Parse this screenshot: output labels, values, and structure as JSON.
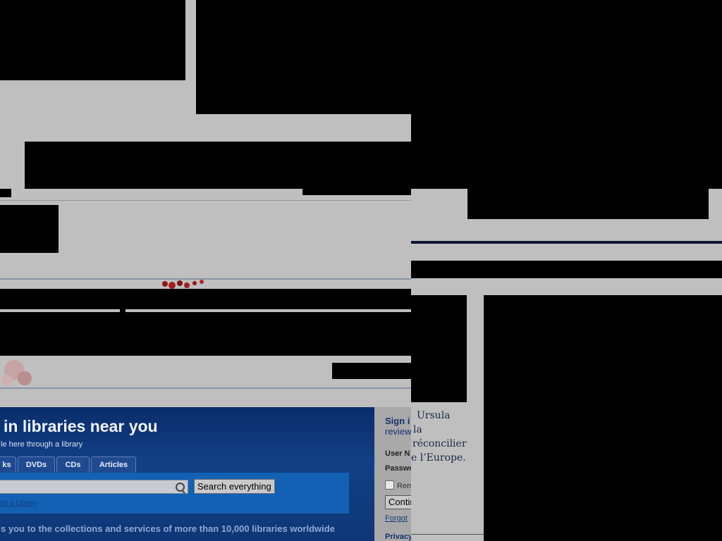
{
  "search_panel": {
    "title": "in libraries near you",
    "subtitle": "le here through a library",
    "tabs": [
      {
        "label": "ks"
      },
      {
        "label": "DVDs"
      },
      {
        "label": "CDs"
      },
      {
        "label": "Articles"
      }
    ],
    "search_input": {
      "value": "",
      "placeholder": ""
    },
    "search_button": "Search everything",
    "find_library_link": "nd a Library",
    "footer_text": "s you to the collections and services of more than 10,000 libraries worldwide"
  },
  "signin": {
    "title": "Sign i",
    "subtitle": "review",
    "username_label": "User N",
    "password_label": "Passwo",
    "remember_label": "Rem",
    "continue_button": "Contin",
    "forgot_link": "Forgot",
    "privacy_label": "Privacy"
  },
  "quote": {
    "lines": [
      "Ursula",
      "la",
      "réconcilier",
      "e l’Europe."
    ]
  },
  "colors": {
    "panel_blue": "#0a2d6b",
    "strip_blue": "#1261b5",
    "page_gray": "#bfbfbf"
  }
}
